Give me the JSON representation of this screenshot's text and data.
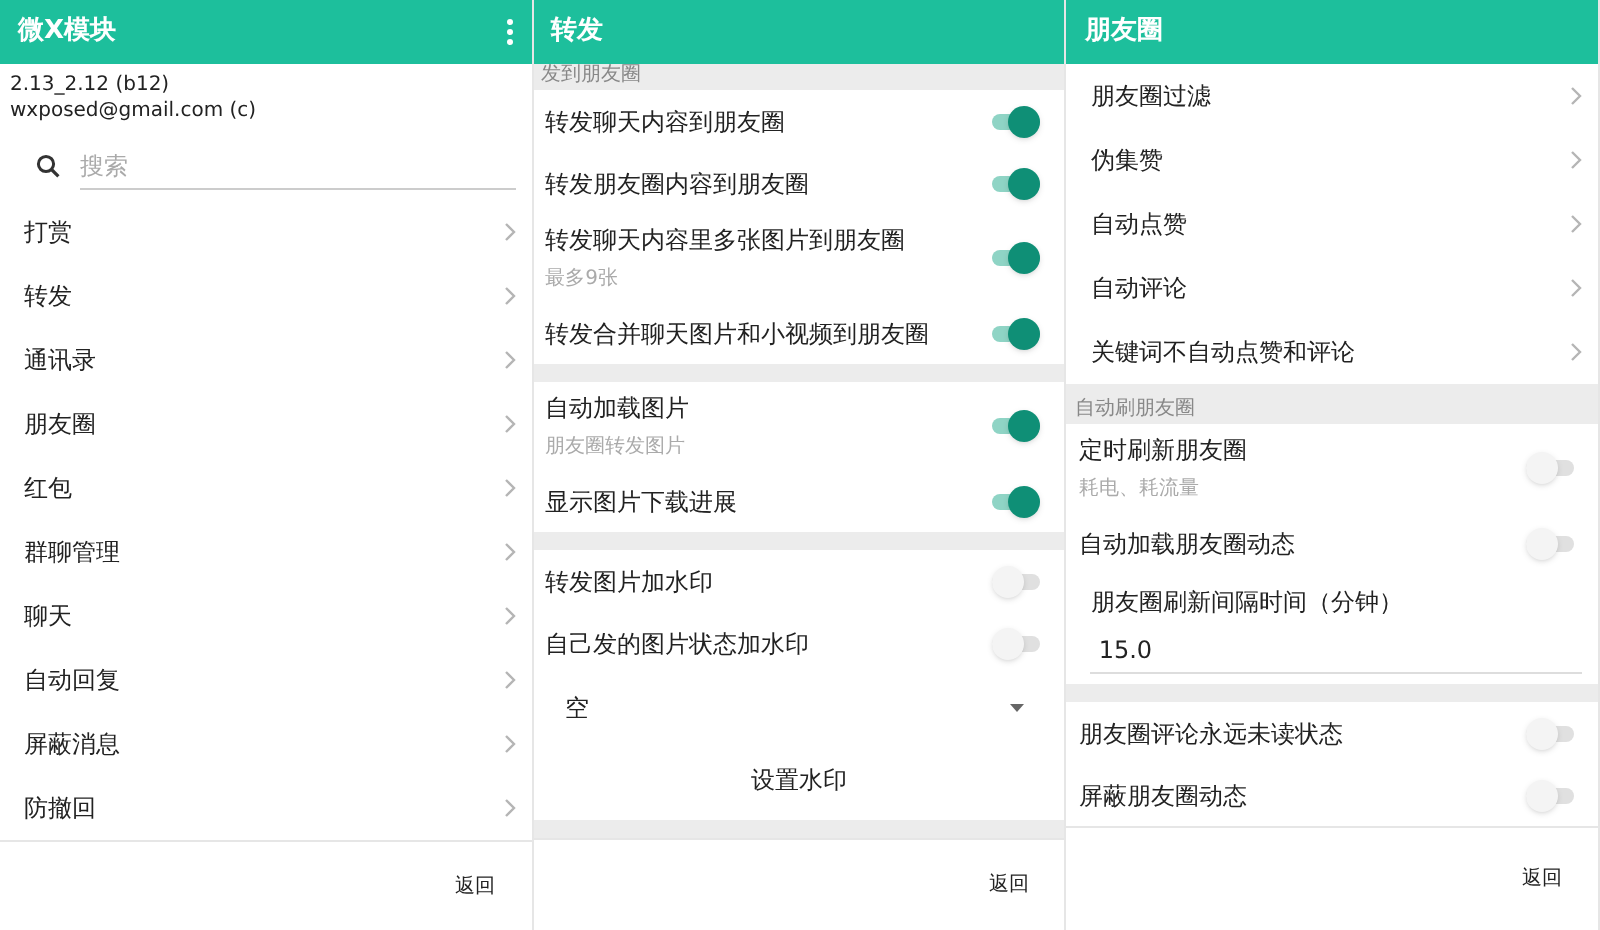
{
  "panels": [
    {
      "title": "微X模块",
      "menu": true,
      "version": "2.13_2.12 (b12)",
      "contact": "wxposed@gmail.com (c)",
      "search": {
        "placeholder": "搜索"
      },
      "rows": [
        {
          "kind": "nav",
          "label": "打赏"
        },
        {
          "kind": "nav",
          "label": "转发"
        },
        {
          "kind": "nav",
          "label": "通讯录"
        },
        {
          "kind": "nav",
          "label": "朋友圈"
        },
        {
          "kind": "nav",
          "label": "红包"
        },
        {
          "kind": "nav",
          "label": "群聊管理"
        },
        {
          "kind": "nav",
          "label": "聊天"
        },
        {
          "kind": "nav",
          "label": "自动回复"
        },
        {
          "kind": "nav",
          "label": "屏蔽消息"
        },
        {
          "kind": "nav",
          "label": "防撤回"
        }
      ],
      "back": "返回"
    },
    {
      "title": "转发",
      "rows": [
        {
          "kind": "section",
          "label": "发到朋友圈"
        },
        {
          "kind": "switch",
          "label": "转发聊天内容到朋友圈",
          "on": true
        },
        {
          "kind": "switch",
          "label": "转发朋友圈内容到朋友圈",
          "on": true
        },
        {
          "kind": "switch",
          "label": "转发聊天内容里多张图片到朋友圈",
          "sub": "最多9张",
          "on": true
        },
        {
          "kind": "switch",
          "label": "转发合并聊天图片和小视频到朋友圈",
          "on": true
        },
        {
          "kind": "gap"
        },
        {
          "kind": "switch",
          "label": "自动加载图片",
          "sub": "朋友圈转发图片",
          "on": true
        },
        {
          "kind": "switch",
          "label": "显示图片下载进展",
          "on": true
        },
        {
          "kind": "gap"
        },
        {
          "kind": "switch",
          "label": "转发图片加水印",
          "on": false
        },
        {
          "kind": "switch",
          "label": "自己发的图片状态加水印",
          "on": false
        },
        {
          "kind": "dropdown",
          "label": "空"
        },
        {
          "kind": "button",
          "label": "设置水印"
        },
        {
          "kind": "gap"
        }
      ],
      "back": "返回"
    },
    {
      "title": "朋友圈",
      "rows": [
        {
          "kind": "nav",
          "label": "朋友圈过滤"
        },
        {
          "kind": "nav",
          "label": "伪集赞"
        },
        {
          "kind": "nav",
          "label": "自动点赞"
        },
        {
          "kind": "nav",
          "label": "自动评论"
        },
        {
          "kind": "nav",
          "label": "关键词不自动点赞和评论"
        },
        {
          "kind": "section",
          "label": "自动刷朋友圈"
        },
        {
          "kind": "switch",
          "label": "定时刷新朋友圈",
          "sub": "耗电、耗流量",
          "on": false
        },
        {
          "kind": "switch",
          "label": "自动加载朋友圈动态",
          "on": false
        },
        {
          "kind": "input",
          "label": "朋友圈刷新间隔时间（分钟）",
          "value": "15.0"
        },
        {
          "kind": "gap"
        },
        {
          "kind": "switch",
          "label": "朋友圈评论永远未读状态",
          "on": false
        },
        {
          "kind": "switch",
          "label": "屏蔽朋友圈动态",
          "on": false
        }
      ],
      "back": "返回"
    }
  ]
}
